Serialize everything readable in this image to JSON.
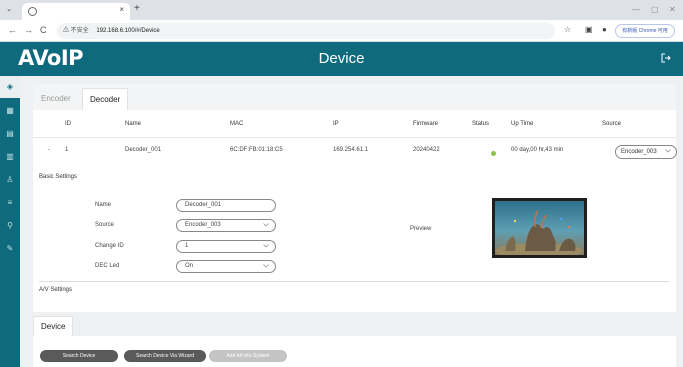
{
  "browser": {
    "tab_close": "×",
    "new_tab": "+",
    "nav_back": "←",
    "nav_forward": "→",
    "nav_reload": "C",
    "security_label": "不安全",
    "url": "192.168.6.100/#/Device",
    "chrome_button": "有新版 Chrome 可用"
  },
  "app": {
    "logo": "AVoIP",
    "title": "Device",
    "accent_color": "#0f6a7d"
  },
  "tabs": [
    {
      "label": "Encoder"
    },
    {
      "label": "Decoder"
    }
  ],
  "table": {
    "headers": [
      "ID",
      "Name",
      "MAC",
      "IP",
      "Firmware",
      "Status",
      "Up Time",
      "Source"
    ],
    "row": {
      "expand": "-",
      "id": "1",
      "name": "Decoder_001",
      "mac": "6C:DF:FB:01:18:C5",
      "ip": "169.254.61.1",
      "firmware": "20240422",
      "status_color": "#8bc34a",
      "uptime": "00 day,00 hr,43 min",
      "source": "Encoder_003"
    }
  },
  "basic_settings": {
    "title": "Basic Settings",
    "name_label": "Name",
    "name_value": "Decoder_001",
    "source_label": "Source",
    "source_value": "Encoder_003",
    "change_id_label": "Change ID",
    "change_id_value": "1",
    "dec_led_label": "DEC Led",
    "dec_led_value": "On",
    "preview_label": "Preview"
  },
  "av_settings": {
    "title": "A/V Settings"
  },
  "device_section": {
    "tab": "Device",
    "buttons": [
      "Search Device",
      "Search Device Via Wizard",
      "Add All into System"
    ]
  }
}
